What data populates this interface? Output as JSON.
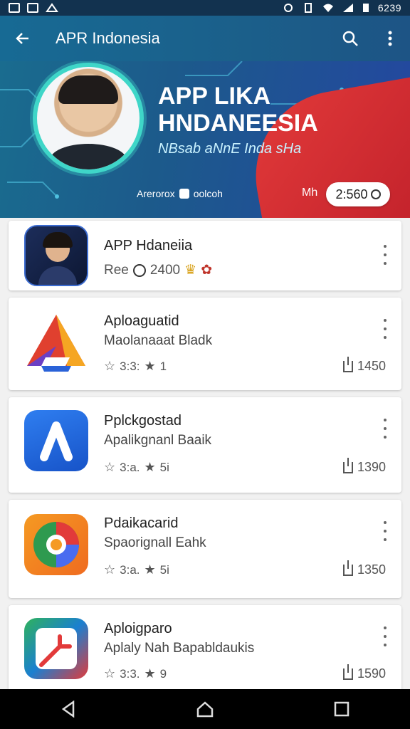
{
  "status_bar": {
    "time": "6239"
  },
  "app_bar": {
    "title": "APR Indonesia"
  },
  "banner": {
    "heading_line1": "APP LIKA",
    "heading_line2": "HNDANEESIA",
    "subtitle": "NBsab aNnE Inda sHa",
    "footer_text": "Arerorox",
    "footer_text2": "oolcoh",
    "price_label": "Mh",
    "price_value": "2:560"
  },
  "apps": [
    {
      "title": "APP Hdaneiia",
      "subtitle": "",
      "meta": "Ree",
      "meta_value": "2400",
      "count": ""
    },
    {
      "title": "Aploaguatid",
      "subtitle": "Maolanaaat Bladk",
      "meta": "3:3:",
      "meta_value": "1",
      "count": "1450"
    },
    {
      "title": "Pplckgostad",
      "subtitle": "Apalikgnanl Baaik",
      "meta": "3:a.",
      "meta_value": "5i",
      "count": "1390"
    },
    {
      "title": "Pdaikacarid",
      "subtitle": "Spaorignall Eahk",
      "meta": "3:a.",
      "meta_value": "5i",
      "count": "1350"
    },
    {
      "title": "Aploigparo",
      "subtitle": "Aplaly Nah Bapabldaukis",
      "meta": "3:3.",
      "meta_value": "9",
      "count": "1590"
    }
  ],
  "icons": [
    "back-arrow-icon",
    "search-icon",
    "more-vert-icon",
    "clock-icon",
    "star-icon",
    "share-icon",
    "nav-back-icon",
    "nav-home-icon",
    "nav-recents-icon"
  ]
}
